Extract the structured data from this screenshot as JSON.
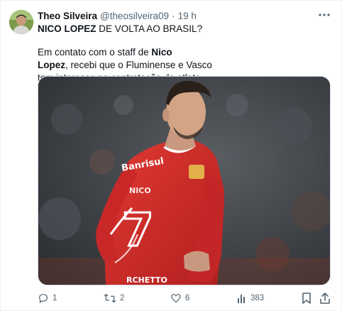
{
  "author": {
    "name": "Theo Silveira",
    "handle": "@theosilveira09",
    "separator": "·",
    "time": "19 h"
  },
  "tweet": {
    "line1_bold": "NICO LOPEZ",
    "line1_rest": " DE VOLTA AO BRASIL?",
    "para_a": "Em contato com o staff de ",
    "para_bold": "Nico Lopez",
    "para_b": ", recebi que o Fluminense e Vasco",
    "para_c": "tem interesse na contratação do atleta."
  },
  "media": {
    "jersey_sponsor": "Banrisul",
    "jersey_name": "NICO",
    "jersey_number": "7",
    "jersey_bottom": "RCHETTO"
  },
  "actions": {
    "replies": "1",
    "reposts": "2",
    "likes": "6",
    "views": "383"
  },
  "icons": {
    "more": "more-dots-icon",
    "reply": "reply-icon",
    "repost": "repost-icon",
    "like": "heart-icon",
    "views": "views-chart-icon",
    "bookmark": "bookmark-icon",
    "share": "share-icon"
  },
  "colors": {
    "text": "#0f1419",
    "muted": "#536471",
    "border": "#cfd9de",
    "jersey": "#d42a2a"
  }
}
